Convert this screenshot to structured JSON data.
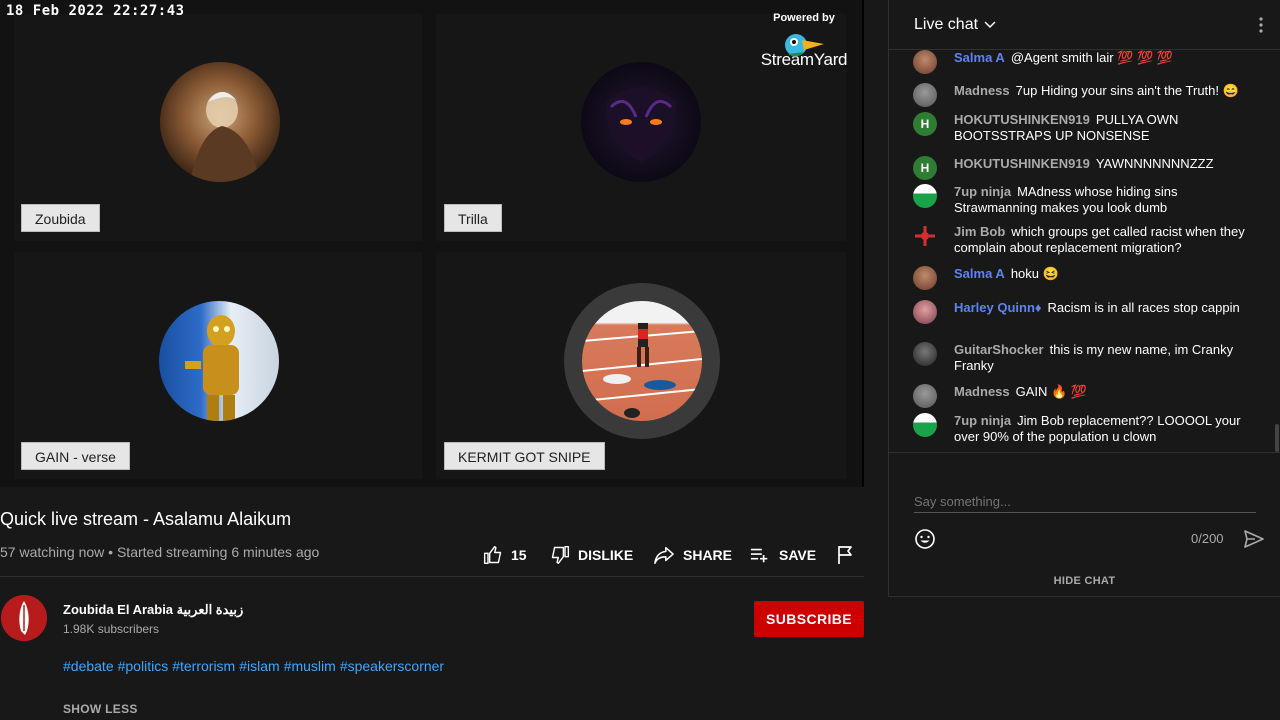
{
  "video": {
    "timestamp": "18 Feb 2022 22:27:43",
    "brand_powered": "Powered by",
    "brand_name": "StreamYard",
    "participants": [
      {
        "name": "Zoubida"
      },
      {
        "name": "Trilla"
      },
      {
        "name": "GAIN - verse"
      },
      {
        "name": "KERMIT GOT SNIPE"
      }
    ]
  },
  "details": {
    "title": "Quick live stream - Asalamu Alaikum",
    "meta": "57 watching now • Started streaming 6 minutes ago",
    "like_count": "15",
    "dislike_label": "DISLIKE",
    "share_label": "SHARE",
    "save_label": "SAVE"
  },
  "channel": {
    "name": "Zoubida El Arabia زبيدة العربية",
    "subscribers": "1.98K subscribers",
    "subscribe_label": "SUBSCRIBE",
    "hashtags": [
      "#debate",
      "#politics",
      "#terrorism",
      "#islam",
      "#muslim",
      "#speakerscorner"
    ],
    "show_less": "SHOW LESS"
  },
  "chat": {
    "title": "Live chat",
    "messages": [
      {
        "author": "Salma A",
        "mod": true,
        "text": "@Agent smith lair 💯 💯 💯"
      },
      {
        "author": "Madness",
        "mod": false,
        "text": "7up Hiding your sins ain't the Truth! 😄"
      },
      {
        "author": "HOKUTUSHINKEN919",
        "mod": false,
        "text": "PULLYA OWN BOOTSSTRAPS UP NONSENSE"
      },
      {
        "author": "HOKUTUSHINKEN919",
        "mod": false,
        "text": "YAWNNNNNNNZZZ"
      },
      {
        "author": "7up ninja",
        "mod": false,
        "text": "MAdness whose hiding sins Strawmanning makes you look dumb"
      },
      {
        "author": "Jim Bob",
        "mod": false,
        "text": "which groups get called racist when they complain about replacement migration?"
      },
      {
        "author": "Salma A",
        "mod": true,
        "text": "hoku 😆"
      },
      {
        "author": "Harley Quinn♦",
        "mod": true,
        "text": "Racism is in all races stop cappin"
      },
      {
        "author": "GuitarShocker",
        "mod": false,
        "text": "this is my new name, im Cranky Franky"
      },
      {
        "author": "Madness",
        "mod": false,
        "text": "GAIN 🔥 💯"
      },
      {
        "author": "7up ninja",
        "mod": false,
        "text": "Jim Bob replacement?? LOOOOL your over 90% of the population u clown"
      }
    ],
    "input_placeholder": "Say something...",
    "counter": "0/200",
    "hide_chat": "HIDE CHAT"
  },
  "colors": {
    "accent_red": "#cc0000",
    "link_blue": "#3ea6ff",
    "moderator_blue": "#5e84f1"
  }
}
